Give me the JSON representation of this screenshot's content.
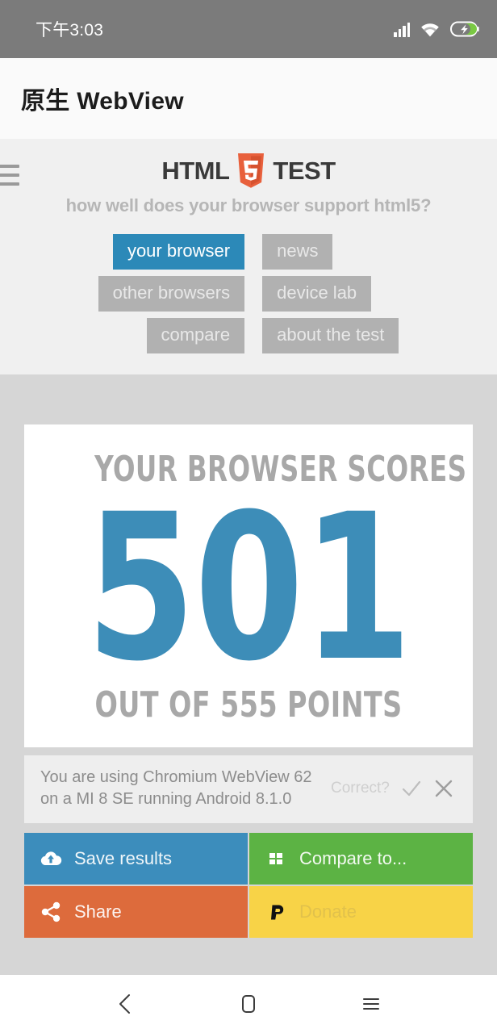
{
  "statusbar": {
    "time": "下午3:03",
    "icons": [
      "signal-icon",
      "wifi-icon",
      "battery-charging-icon"
    ]
  },
  "appbar": {
    "title": "原生 WebView"
  },
  "site": {
    "menu_icon": "hamburger-menu-icon",
    "logo": {
      "left_word": "HTML",
      "shield_digit": "5",
      "right_word": "TEST"
    },
    "tagline": "how well does your browser support html5?",
    "nav": {
      "left": [
        {
          "label": "your browser",
          "active": true
        },
        {
          "label": "other browsers",
          "active": false
        },
        {
          "label": "compare",
          "active": false
        }
      ],
      "right": [
        {
          "label": "news",
          "active": false
        },
        {
          "label": "device lab",
          "active": false
        },
        {
          "label": "about the test",
          "active": false
        }
      ]
    }
  },
  "score": {
    "label": "YOUR BROWSER SCORES",
    "value": "501",
    "sub": "OUT OF 555 POINTS",
    "max": "555",
    "color": "#3d8db8"
  },
  "info": {
    "text": "You are using Chromium WebView 62 on a MI 8 SE running Android 8.1.0",
    "correct_label": "Correct?",
    "confirm_icon": "check-icon",
    "reject_icon": "close-icon"
  },
  "actions": [
    {
      "label": "Save results",
      "icon": "cloud-upload-icon",
      "color": "#3c8dbc"
    },
    {
      "label": "Compare to...",
      "icon": "grid-icon",
      "color": "#5cb344"
    },
    {
      "label": "Share",
      "icon": "share-nodes-icon",
      "color": "#dd6b3c"
    },
    {
      "label": "Donate",
      "icon": "paypal-icon",
      "color": "#f8d347"
    }
  ],
  "navbar": {
    "back": "back-icon",
    "home": "home-icon",
    "recents": "recents-icon"
  },
  "colors": {
    "accent_blue": "#2c89b8",
    "html5_orange": "#e34f26",
    "page_bg": "#d6d6d6",
    "header_bg": "#f0f0f0"
  }
}
